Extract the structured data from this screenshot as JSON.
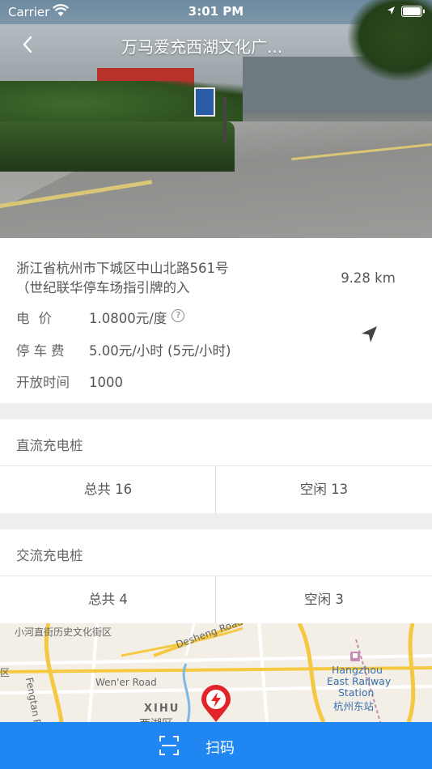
{
  "status_bar": {
    "carrier": "Carrier",
    "time": "3:01 PM"
  },
  "header": {
    "title": "万马爱充西湖文化广..."
  },
  "station": {
    "address": "浙江省杭州市下城区中山北路561号（世纪联华停车场指引牌的入",
    "distance": "9.28 km",
    "price_label": "电价",
    "price_value": "1.0800元/度",
    "help_icon_text": "?",
    "parking_label": "停车费",
    "parking_value": "5.00元/小时 (5元/小时)",
    "hours_label": "开放时间",
    "hours_value": "1000"
  },
  "dc": {
    "title": "直流充电桩",
    "total": "总共 16",
    "idle": "空闲 13"
  },
  "ac": {
    "title": "交流充电桩",
    "total": "总共 4",
    "idle": "空闲 3"
  },
  "map": {
    "labels": {
      "district": "小河直街历史文化街区",
      "desheng": "Desheng Road",
      "fengtan": "Fengtan Road",
      "wener": "Wen'er Road",
      "xihu": "XIHU",
      "xihu_cn": "西湖区",
      "hangzhou": "Hangzhou",
      "east_railway": "East Railway",
      "station": "Station",
      "station_cn": "杭州东站",
      "edge_left": "区"
    }
  },
  "scan": {
    "label": "扫码"
  },
  "colors": {
    "accent": "#1f86f2",
    "pin": "#e3232a"
  },
  "icons": [
    "wifi-icon",
    "battery-icon",
    "back-chevron-icon",
    "navigation-arrow-icon",
    "help-icon",
    "charging-pin-icon",
    "scan-icon"
  ]
}
